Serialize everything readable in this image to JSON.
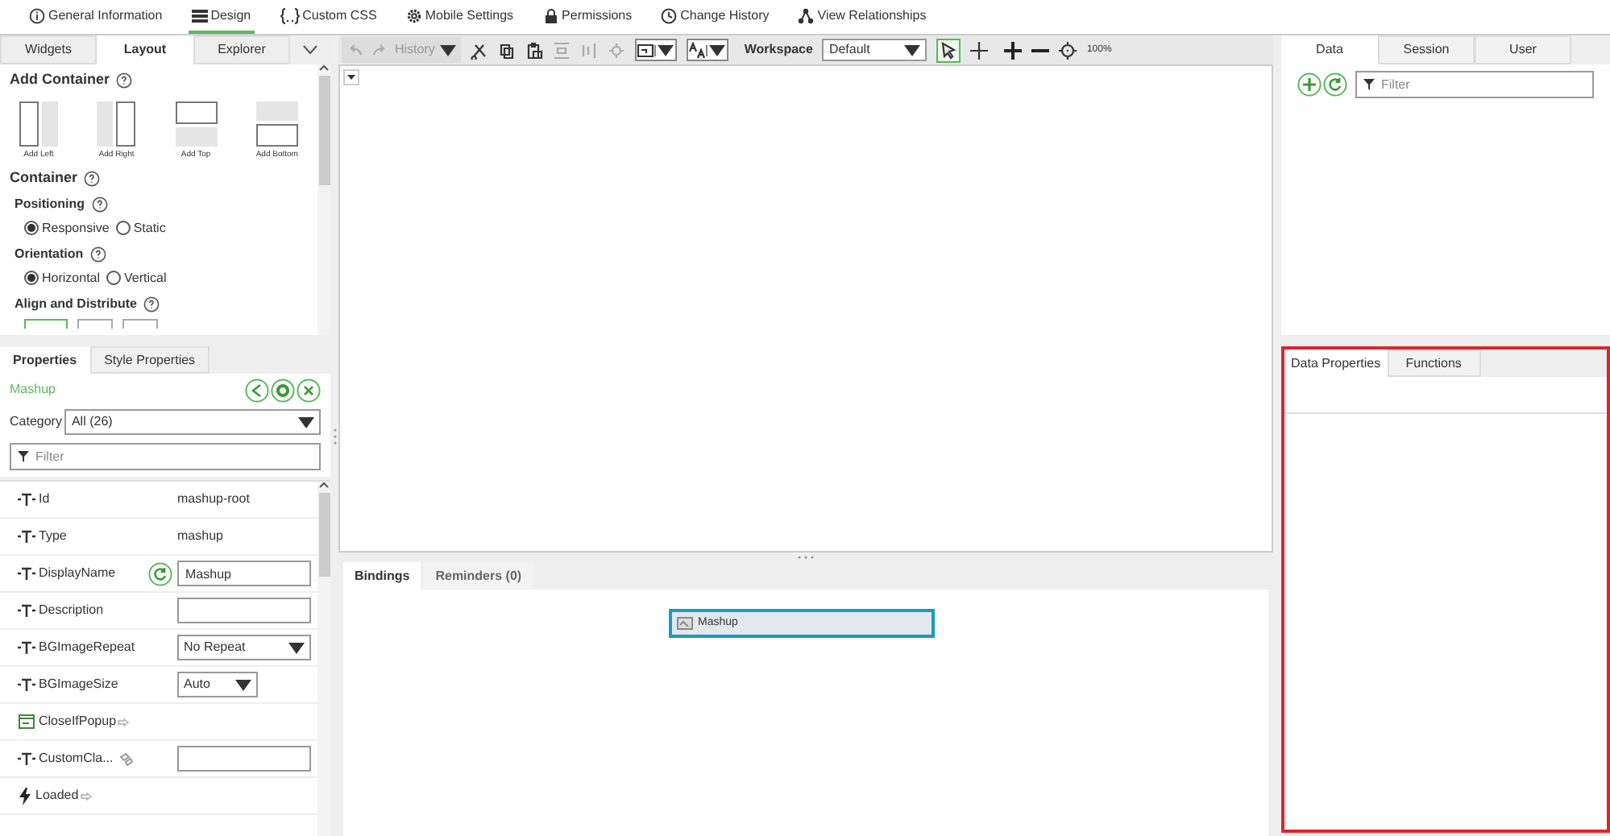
{
  "top_tabs": [
    {
      "label": "General Information",
      "selected": false
    },
    {
      "label": "Design",
      "selected": true
    },
    {
      "label": "Custom CSS",
      "selected": false
    },
    {
      "label": "Mobile Settings",
      "selected": false
    },
    {
      "label": "Permissions",
      "selected": false
    },
    {
      "label": "Change History",
      "selected": false
    },
    {
      "label": "View Relationships",
      "selected": false
    }
  ],
  "left_tabs": [
    {
      "label": "Widgets",
      "selected": false
    },
    {
      "label": "Layout",
      "selected": true
    },
    {
      "label": "Explorer",
      "selected": false
    }
  ],
  "layout_panel": {
    "add_container_title": "Add Container",
    "add_buttons": [
      "Add Left",
      "Add Right",
      "Add Top",
      "Add Bottom"
    ],
    "container_title": "Container",
    "positioning_label": "Positioning",
    "positioning_options": [
      {
        "label": "Responsive",
        "selected": true
      },
      {
        "label": "Static",
        "selected": false
      }
    ],
    "orientation_label": "Orientation",
    "orientation_options": [
      {
        "label": "Horizontal",
        "selected": true
      },
      {
        "label": "Vertical",
        "selected": false
      }
    ],
    "align_label": "Align and Distribute",
    "align_options": [
      {
        "selected": true
      },
      {
        "selected": false
      },
      {
        "selected": false
      }
    ]
  },
  "properties_tabs": [
    {
      "label": "Properties",
      "selected": true
    },
    {
      "label": "Style Properties",
      "selected": false
    }
  ],
  "properties": {
    "entity": "Mashup",
    "category_label": "Category",
    "category_value": "All (26)",
    "filter_placeholder": "Filter",
    "rows": [
      {
        "name": "Id",
        "kind": "static",
        "value": "mashup-root"
      },
      {
        "name": "Type",
        "kind": "static",
        "value": "mashup"
      },
      {
        "name": "DisplayName",
        "kind": "input",
        "value": "Mashup",
        "reset": true
      },
      {
        "name": "Description",
        "kind": "input"
      },
      {
        "name": "BGImageRepeat",
        "kind": "select",
        "value": "No Repeat"
      },
      {
        "name": "BGImageSize",
        "kind": "smallselect",
        "value": "Auto"
      },
      {
        "name": "CloseIfPopup",
        "kind": "service"
      },
      {
        "name": "CustomCla...",
        "kind": "input",
        "linked": true
      },
      {
        "name": "Loaded",
        "kind": "event"
      }
    ]
  },
  "toolbar": {
    "history": "History",
    "workspace_label": "Workspace",
    "workspace_value": "Default",
    "zoom": "100%"
  },
  "bottom_tabs": [
    {
      "label": "Bindings",
      "selected": true
    },
    {
      "label": "Reminders (0)",
      "selected": false
    }
  ],
  "binding_node": "Mashup",
  "right_tabs": [
    {
      "label": "Data",
      "selected": true
    },
    {
      "label": "Session",
      "selected": false
    },
    {
      "label": "User",
      "selected": false
    }
  ],
  "data_filter_placeholder": "Filter",
  "data_props_tabs": [
    {
      "label": "Data Properties",
      "selected": true
    },
    {
      "label": "Functions",
      "selected": false
    }
  ]
}
